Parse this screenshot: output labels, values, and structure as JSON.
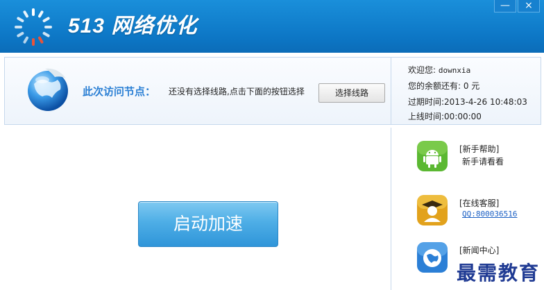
{
  "window": {
    "title": "513 网络优化",
    "minimize_label": "—",
    "close_label": "×"
  },
  "info": {
    "node_label": "此次访问节点：",
    "node_value": "还没有选择线路,点击下面的按钮选择",
    "select_button": "选择线路"
  },
  "account": {
    "welcome": "欢迎您:",
    "username": "downxia",
    "balance": "您的余额还有: 0 元",
    "expire_label": "过期时间:",
    "expire_value": "2013-4-26 10:48:03",
    "online_label": "上线时间:",
    "online_value": "00:00:00"
  },
  "main": {
    "start_button": "启动加速"
  },
  "sidebar": {
    "items": [
      {
        "title": "[新手帮助]",
        "subtitle": "新手请看看",
        "icon": "android-icon",
        "color": "#5bb832"
      },
      {
        "title": "[在线客服]",
        "subtitle": "QQ:800036516",
        "icon": "graduate-icon",
        "color": "#e2a21c"
      },
      {
        "title": "[新闻中心]",
        "subtitle": "",
        "icon": "globe-icon",
        "color": "#2b7fd6"
      }
    ]
  },
  "watermark": "最需教育",
  "colors": {
    "titlebar": "#0d77c6",
    "accent": "#2a7fd4",
    "start_button": "#4eaee6"
  }
}
